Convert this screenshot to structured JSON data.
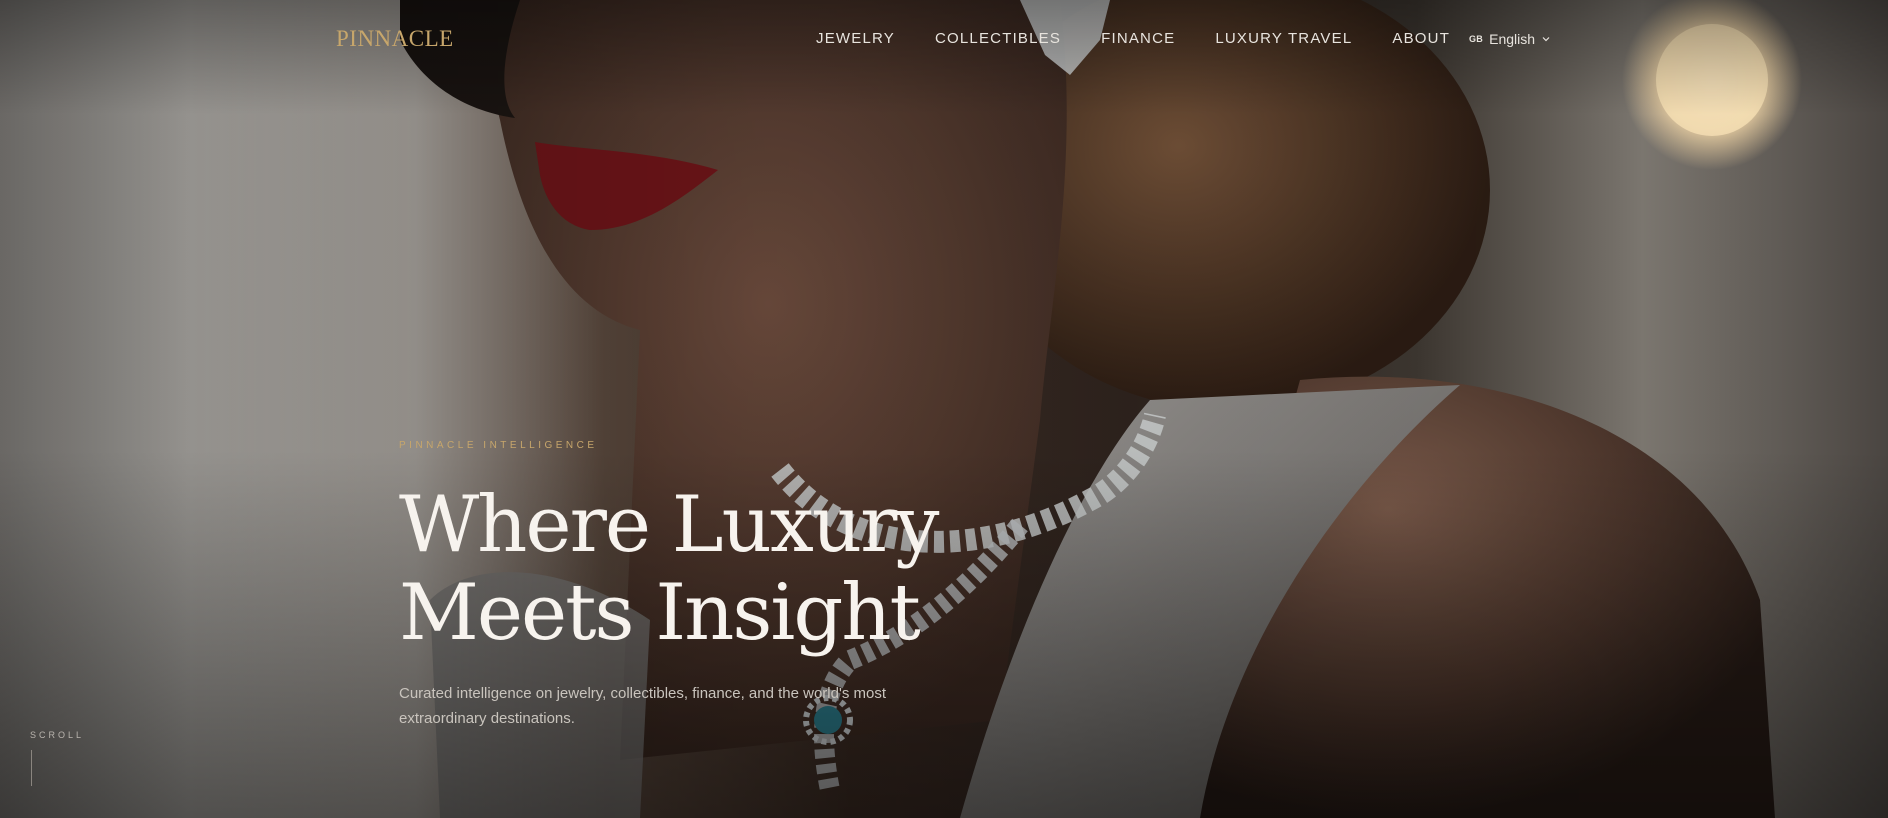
{
  "brand": {
    "logo": "PINNACLE",
    "accent_color": "#c7a66b"
  },
  "nav": {
    "items": [
      {
        "label": "JEWELRY"
      },
      {
        "label": "COLLECTIBLES"
      },
      {
        "label": "FINANCE"
      },
      {
        "label": "LUXURY TRAVEL"
      },
      {
        "label": "ABOUT"
      }
    ],
    "language": {
      "flag": "GB",
      "label": "English",
      "icon": "chevron-down-icon"
    }
  },
  "hero": {
    "eyebrow": "PINNACLE INTELLIGENCE",
    "headline_line1": "Where Luxury",
    "headline_line2": "Meets Insight",
    "subtitle": "Curated intelligence on jewelry, collectibles, finance, and the world's most extraordinary destinations."
  },
  "scroll": {
    "label": "SCROLL"
  }
}
